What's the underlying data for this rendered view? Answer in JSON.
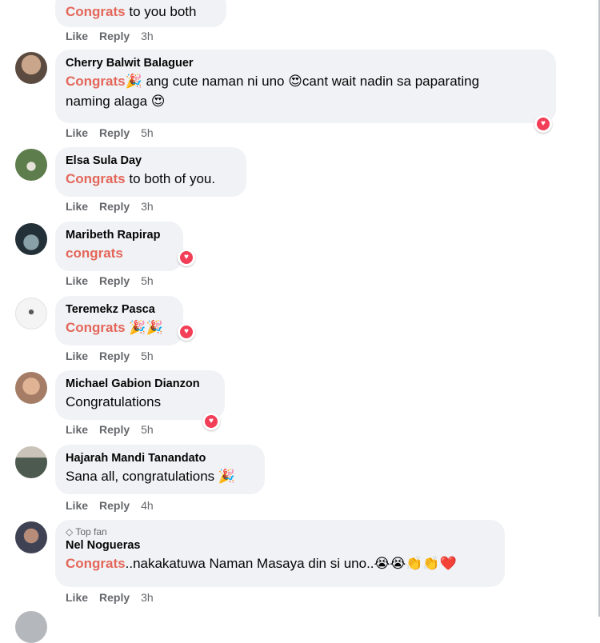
{
  "actions": {
    "like": "Like",
    "reply": "Reply"
  },
  "comments": [
    {
      "name": "",
      "hl": "Congrats",
      "text": " to you both",
      "emoji": "",
      "time": "3h"
    },
    {
      "name": "Cherry Balwit Balaguer",
      "hl": "Congrats",
      "text": "🎉 ang cute naman ni uno 😍cant wait nadin sa paparating",
      "line2": "naming alaga 😍",
      "time": "5h"
    },
    {
      "name": "Elsa Sula Day",
      "hl": "Congrats",
      "text": " to both of you.",
      "time": "3h"
    },
    {
      "name": "Maribeth Rapirap",
      "hl": "congrats",
      "text": "",
      "time": "5h"
    },
    {
      "name": "Teremekz Pasca",
      "hl": "Congrats",
      "text": " 🎉🎉",
      "time": "5h"
    },
    {
      "name": "Michael Gabion Dianzon",
      "hl": "",
      "text": "Congratulations",
      "time": "5h"
    },
    {
      "name": "Hajarah Mandi Tanandato",
      "hl": "",
      "text": "Sana all, congratulations 🎉",
      "time": "4h"
    },
    {
      "badge": "Top fan",
      "name": "Nel Nogueras",
      "hl": "Congrats",
      "text": "..nakakatuwa Naman Masaya din si uno..😭😭👏👏❤️",
      "time": "3h"
    }
  ],
  "colors": {
    "highlight": "#e4665a",
    "bubble": "#f0f2f5",
    "heart": "#f33e58"
  }
}
